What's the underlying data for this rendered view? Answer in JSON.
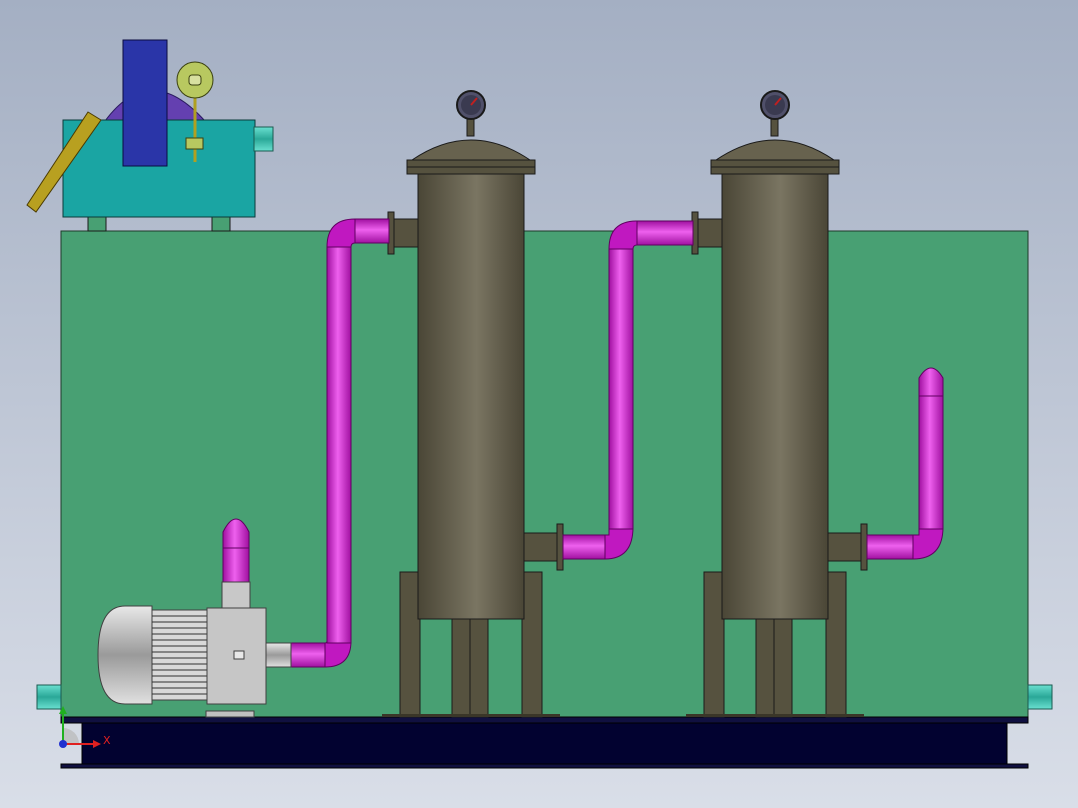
{
  "view": {
    "axis_x_label": "X",
    "axis_y_label": "",
    "axis_colors": {
      "x": "#e02020",
      "y": "#20b020",
      "z": "#2030d0"
    }
  },
  "colors": {
    "background_top": "#a4afc3",
    "background_bottom": "#d9dee8",
    "tank": "#48a073",
    "base": "#020230",
    "pipe": "#cc18cc",
    "pipe_highlight": "#f070f0",
    "vessel": "#56523f",
    "vessel_highlight": "#787360",
    "machine_body": "#1aa5a3",
    "machine_block": "#2a35a8",
    "motor": "#b0b0b0",
    "nozzle": "#3dc4b3"
  },
  "icons": [
    "pressure-gauge-icon",
    "coordinate-axis-icon"
  ]
}
